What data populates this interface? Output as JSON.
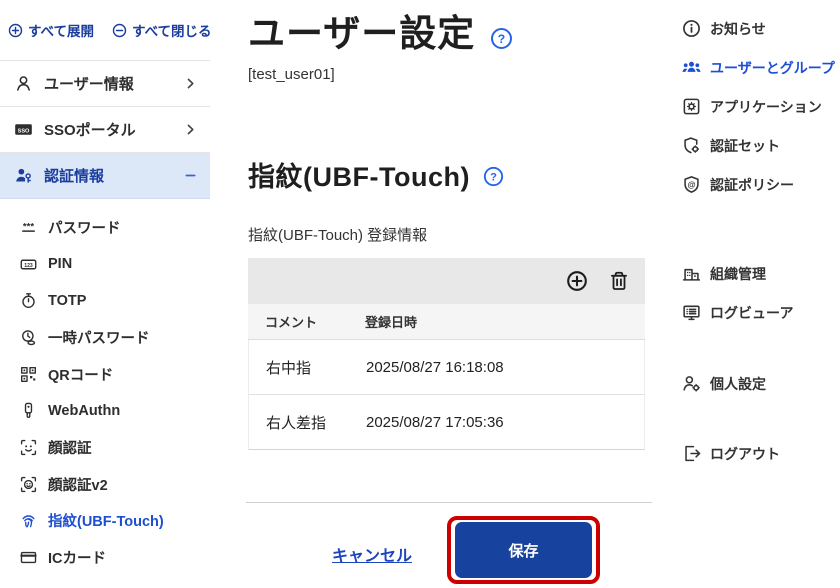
{
  "colors": {
    "navy_link": "#1b3d9e",
    "active_item_bg": "#dce8f8",
    "active_blue": "#1d4ed8",
    "save_button_bg": "#17429e",
    "annotation_red": "#cc0000",
    "help_blue": "#2563eb"
  },
  "left_sidebar": {
    "expand_label": "すべて展開",
    "collapse_label": "すべて閉じる",
    "main_items": [
      {
        "label": "ユーザー情報",
        "icon": "user-icon",
        "trailing": "chevron-right-icon",
        "active": false
      },
      {
        "label": "SSOポータル",
        "icon": "sso-icon",
        "trailing": "chevron-right-icon",
        "active": false
      },
      {
        "label": "認証情報",
        "icon": "user-key-icon",
        "trailing": "minus-icon",
        "active": true
      }
    ],
    "sub_items": [
      {
        "label": "パスワード",
        "icon": "password-icon",
        "active": false
      },
      {
        "label": "PIN",
        "icon": "pin-icon",
        "active": false
      },
      {
        "label": "TOTP",
        "icon": "totp-icon",
        "active": false
      },
      {
        "label": "一時パスワード",
        "icon": "temp-password-icon",
        "active": false
      },
      {
        "label": "QRコード",
        "icon": "qr-code-icon",
        "active": false
      },
      {
        "label": "WebAuthn",
        "icon": "security-key-icon",
        "active": false
      },
      {
        "label": "顔認証",
        "icon": "face-icon",
        "active": false
      },
      {
        "label": "顔認証v2",
        "icon": "face-v2-icon",
        "active": false
      },
      {
        "label": "指紋(UBF-Touch)",
        "icon": "fingerprint-icon",
        "active": true
      },
      {
        "label": "ICカード",
        "icon": "ic-card-icon",
        "active": false
      }
    ]
  },
  "main": {
    "title": "ユーザー設定",
    "subtitle": "[test_user01]",
    "section_title": "指紋(UBF-Touch)",
    "table_label": "指紋(UBF-Touch) 登録情報",
    "table": {
      "columns": [
        "コメント",
        "登録日時"
      ],
      "rows": [
        {
          "comment": "右中指",
          "registered_at": "2025/08/27 16:18:08"
        },
        {
          "comment": "右人差指",
          "registered_at": "2025/08/27 17:05:36"
        }
      ],
      "toolbar_icons": [
        "add-icon",
        "delete-icon"
      ]
    },
    "cancel_label": "キャンセル",
    "save_label": "保存"
  },
  "right_sidebar": {
    "groups": [
      [
        {
          "label": "お知らせ",
          "icon": "info-icon",
          "active": false
        },
        {
          "label": "ユーザーとグループ",
          "icon": "users-group-icon",
          "active": true
        },
        {
          "label": "アプリケーション",
          "icon": "application-icon",
          "active": false
        },
        {
          "label": "認証セット",
          "icon": "auth-set-icon",
          "active": false
        },
        {
          "label": "認証ポリシー",
          "icon": "auth-policy-icon",
          "active": false
        }
      ],
      [
        {
          "label": "組織管理",
          "icon": "organization-icon",
          "active": false
        },
        {
          "label": "ログビューア",
          "icon": "log-viewer-icon",
          "active": false
        }
      ],
      [
        {
          "label": "個人設定",
          "icon": "personal-settings-icon",
          "active": false
        }
      ],
      [
        {
          "label": "ログアウト",
          "icon": "logout-icon",
          "active": false
        }
      ]
    ]
  }
}
